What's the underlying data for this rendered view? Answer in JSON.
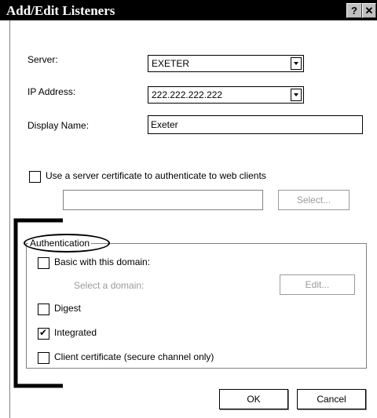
{
  "window": {
    "title": "Add/Edit Listeners",
    "help_label": "?",
    "close_label": "✕"
  },
  "server": {
    "label": "Server:",
    "value": "EXETER"
  },
  "ip_address": {
    "label": "IP Address:",
    "value": "222.222.222.222"
  },
  "display_name": {
    "label": "Display Name:",
    "value": "Exeter"
  },
  "certificate": {
    "label": "Use a server certificate to authenticate to web clients",
    "checked": false,
    "field_value": "",
    "select_button": "Select..."
  },
  "authentication": {
    "group_label": "Authentication",
    "basic": {
      "label": "Basic with this domain:",
      "checked": false
    },
    "domain_label": "Select a domain:",
    "edit_button": "Edit...",
    "digest": {
      "label": "Digest",
      "checked": false
    },
    "integrated": {
      "label": "Integrated",
      "checked": true
    },
    "client_cert": {
      "label": "Client certificate (secure channel only)",
      "checked": false
    }
  },
  "buttons": {
    "ok": "OK",
    "cancel": "Cancel"
  }
}
